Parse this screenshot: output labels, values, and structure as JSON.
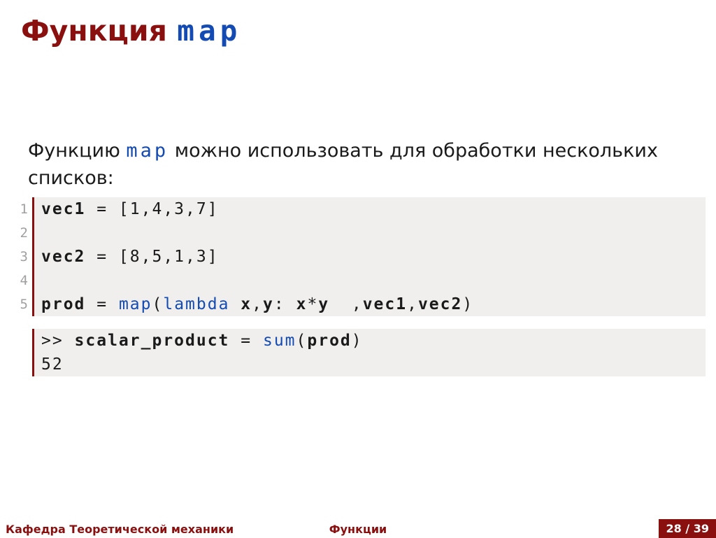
{
  "title": {
    "word": "Функция",
    "code": "map"
  },
  "paragraph": {
    "pre": "Функцию ",
    "code": "map",
    "post": " можно использовать для обработки нескольких списков:"
  },
  "code1": {
    "lines": [
      {
        "n": "1",
        "tokens": [
          {
            "t": "vec1",
            "c": "bold"
          },
          {
            "t": " = [1,4,3,7]",
            "c": "plain"
          }
        ]
      },
      {
        "n": "2",
        "tokens": []
      },
      {
        "n": "3",
        "tokens": [
          {
            "t": "vec2",
            "c": "bold"
          },
          {
            "t": " = [8,5,1,3]",
            "c": "plain"
          }
        ]
      },
      {
        "n": "4",
        "tokens": []
      },
      {
        "n": "5",
        "tokens": [
          {
            "t": "prod",
            "c": "bold"
          },
          {
            "t": " = ",
            "c": "plain"
          },
          {
            "t": "map",
            "c": "blue"
          },
          {
            "t": "(",
            "c": "plain"
          },
          {
            "t": "lambda",
            "c": "blue"
          },
          {
            "t": " ",
            "c": "plain"
          },
          {
            "t": "x",
            "c": "bold"
          },
          {
            "t": ",",
            "c": "plain"
          },
          {
            "t": "y",
            "c": "bold"
          },
          {
            "t": ": ",
            "c": "plain"
          },
          {
            "t": "x",
            "c": "bold"
          },
          {
            "t": "*",
            "c": "plain"
          },
          {
            "t": "y",
            "c": "bold"
          },
          {
            "t": "  ,",
            "c": "plain"
          },
          {
            "t": "vec1",
            "c": "bold"
          },
          {
            "t": ",",
            "c": "plain"
          },
          {
            "t": "vec2",
            "c": "bold"
          },
          {
            "t": ")",
            "c": "plain"
          }
        ]
      }
    ]
  },
  "code2": {
    "lines": [
      {
        "n": "",
        "tokens": [
          {
            "t": ">> ",
            "c": "plain"
          },
          {
            "t": "scalar_product",
            "c": "bold"
          },
          {
            "t": " = ",
            "c": "plain"
          },
          {
            "t": "sum",
            "c": "blue"
          },
          {
            "t": "(",
            "c": "plain"
          },
          {
            "t": "prod",
            "c": "bold"
          },
          {
            "t": ")",
            "c": "plain"
          }
        ]
      },
      {
        "n": "",
        "tokens": [
          {
            "t": "52",
            "c": "plain"
          }
        ]
      }
    ]
  },
  "footer": {
    "left": "Кафедра Теоретической механики",
    "center": "Функции",
    "right": "28 / 39"
  }
}
